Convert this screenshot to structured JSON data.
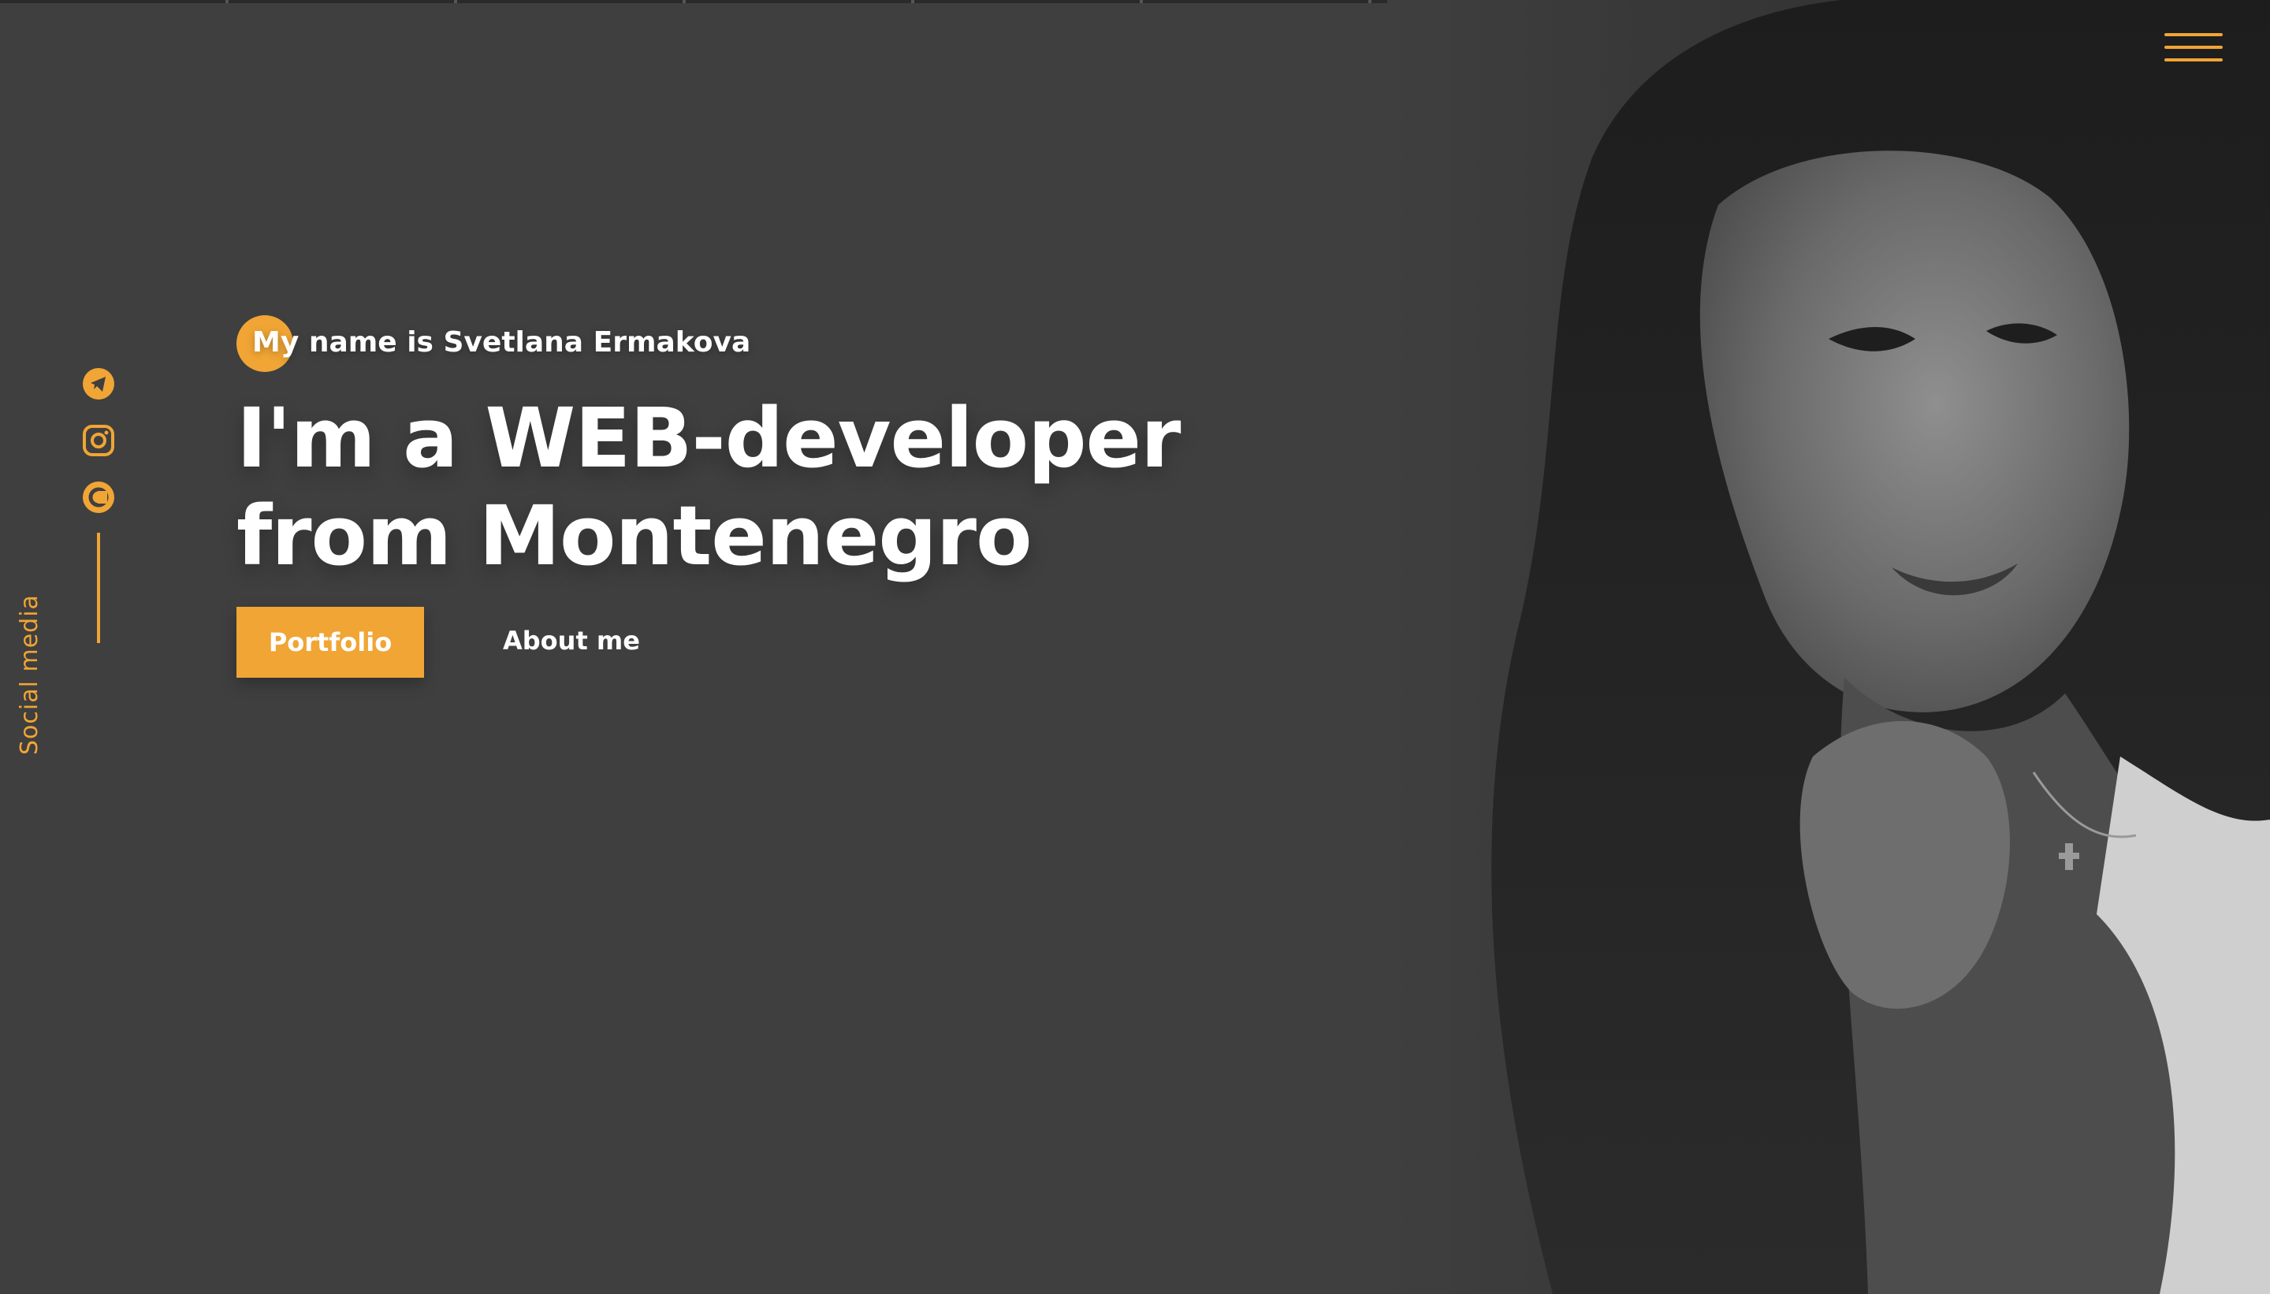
{
  "colors": {
    "background": "#3f3f3f",
    "accent": "#f0a535",
    "text": "#ffffff"
  },
  "header": {
    "menu_icon": "hamburger-menu-icon"
  },
  "social": {
    "label": "Social media",
    "icons": [
      "telegram-icon",
      "instagram-icon",
      "codepen-icon"
    ]
  },
  "hero": {
    "intro": "My name is Svetlana Ermakova",
    "headline": "I'm a WEB-developer from Montenegro",
    "primary_button": "Portfolio",
    "secondary_link": "About me"
  }
}
